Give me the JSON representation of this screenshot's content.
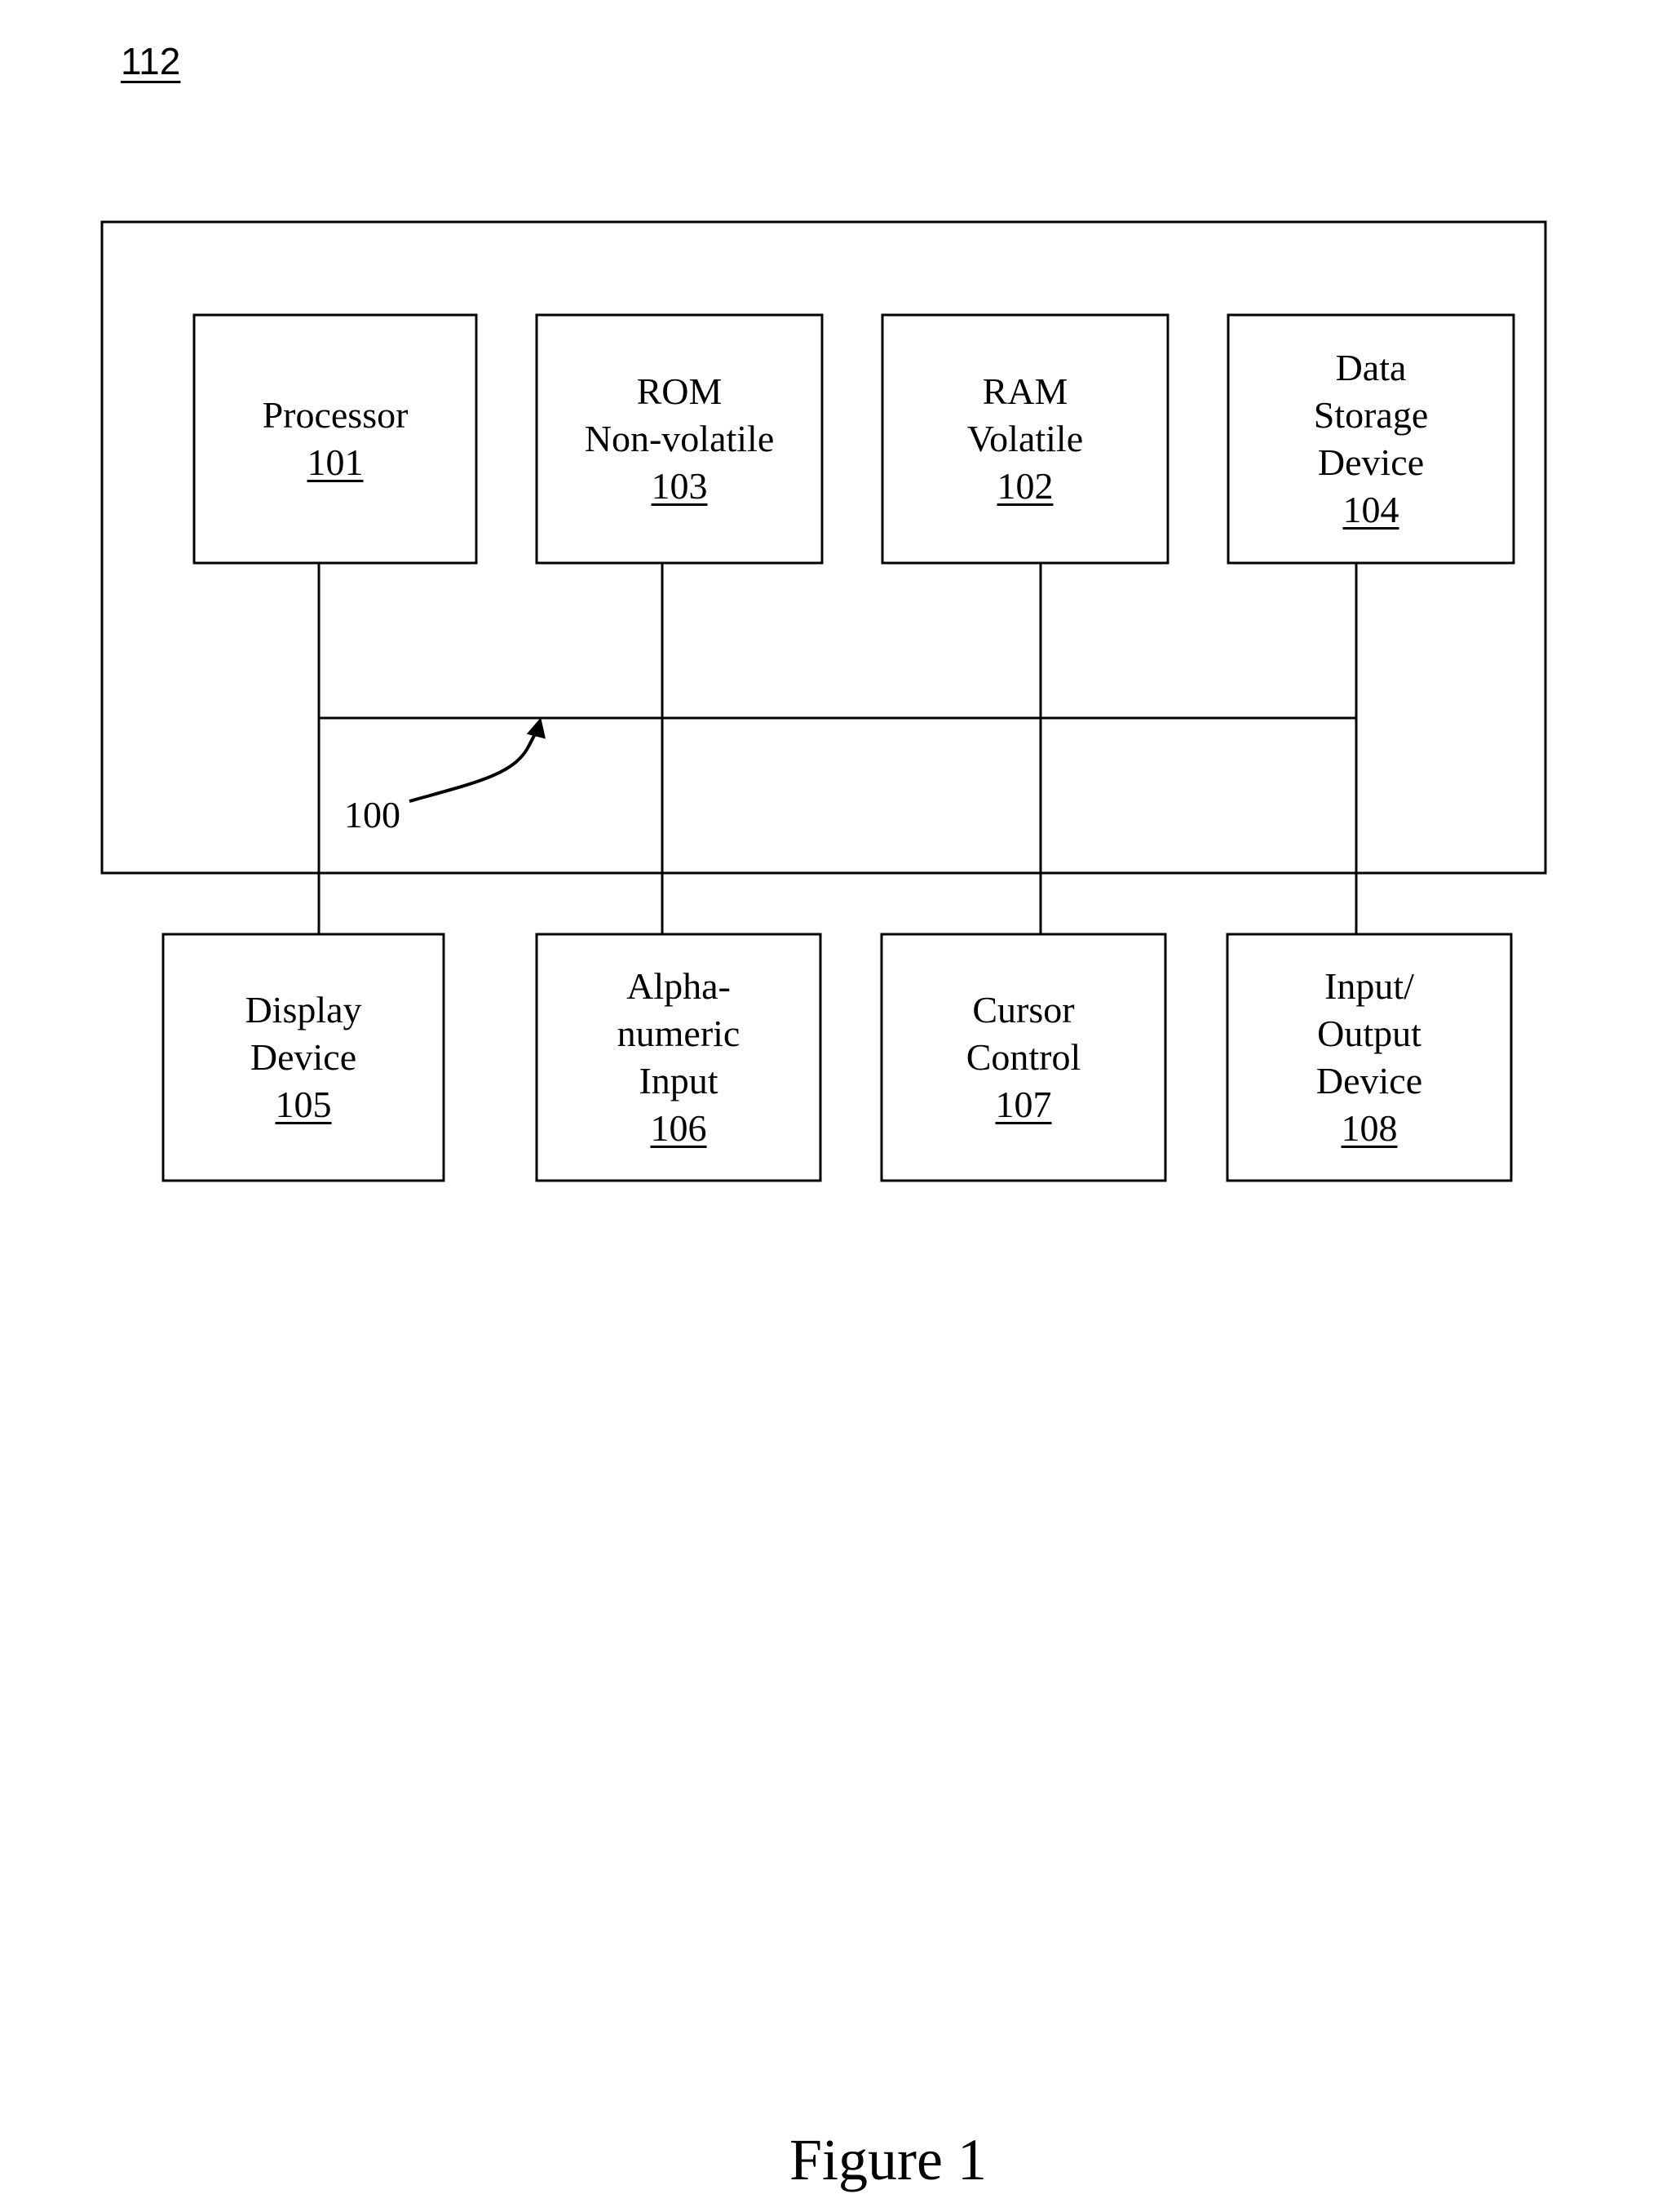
{
  "figure_ref": "112",
  "caption": "Figure 1",
  "bus": {
    "label": "100"
  },
  "internal_blocks": [
    {
      "lines": [
        "Processor"
      ],
      "num": "101"
    },
    {
      "lines": [
        "ROM",
        "Non-volatile"
      ],
      "num": "103"
    },
    {
      "lines": [
        "RAM",
        "Volatile"
      ],
      "num": "102"
    },
    {
      "lines": [
        "Data",
        "Storage",
        "Device"
      ],
      "num": "104"
    }
  ],
  "external_blocks": [
    {
      "lines": [
        "Display",
        "Device"
      ],
      "num": "105"
    },
    {
      "lines": [
        "Alpha-",
        "numeric",
        "Input"
      ],
      "num": "106"
    },
    {
      "lines": [
        "Cursor",
        "Control"
      ],
      "num": "107"
    },
    {
      "lines": [
        "Input/",
        "Output",
        "Device"
      ],
      "num": "108"
    }
  ]
}
